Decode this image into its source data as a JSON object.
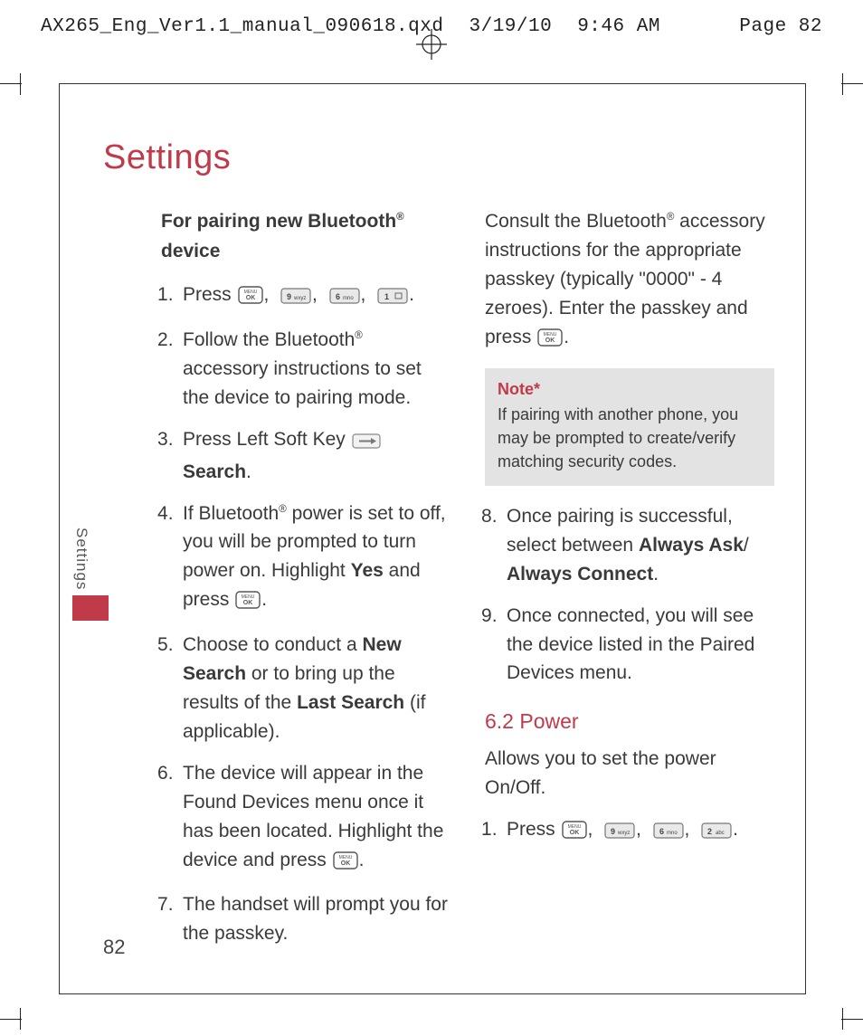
{
  "slug": {
    "file": "AX265_Eng_Ver1.1_manual_090618.qxd",
    "date": "3/19/10",
    "time": "9:46 AM",
    "page": "Page 82"
  },
  "title": "Settings",
  "sideTab": "Settings",
  "pageNumber": "82",
  "left": {
    "heading_a": "For pairing new Bluetooth",
    "heading_b": "device",
    "s1_a": "Press ",
    "s2_a": "Follow the Bluetooth",
    "s2_b": " accessory instructions to set the device to pairing mode.",
    "s3_a": "Press Left Soft Key ",
    "s3_b": "Search",
    "s3_c": ".",
    "s4_a": "If Bluetooth",
    "s4_b": " power is set to off, you will be prompted to turn power on. Highlight ",
    "s4_c": "Yes",
    "s4_d": " and press ",
    "s5_a": "Choose to conduct a ",
    "s5_b": "New Search",
    "s5_c": " or to bring up the results of the ",
    "s5_d": "Last Search",
    "s5_e": " (if applicable).",
    "s6_a": "The device will appear in the Found Devices menu once it has been located. Highlight the device and press ",
    "s7_a": "The handset will prompt you for the passkey."
  },
  "right": {
    "consult_a": "Consult the Bluetooth",
    "consult_b": " accessory instructions for the appropriate passkey (typically \"0000\" - 4 zeroes). Enter the passkey and press ",
    "note_title": "Note*",
    "note_body": "If pairing with another phone, you may be prompted to create/verify matching security codes.",
    "s8_a": "Once pairing is successful, select between ",
    "s8_b": "Always Ask",
    "s8_c": "/",
    "s8_d": "Always Connect",
    "s8_e": ".",
    "s9_a": "Once connected, you will see the device listed in the Paired Devices menu.",
    "sec_head": "6.2 Power",
    "sec_intro": "Allows you to set the power On/Off.",
    "p1_a": "Press "
  },
  "keys": {
    "ok": "MENU OK",
    "k9": "9 wxyz",
    "k6": "6 mno",
    "k1": "1",
    "k2": "2 abc",
    "soft": "soft-key"
  }
}
